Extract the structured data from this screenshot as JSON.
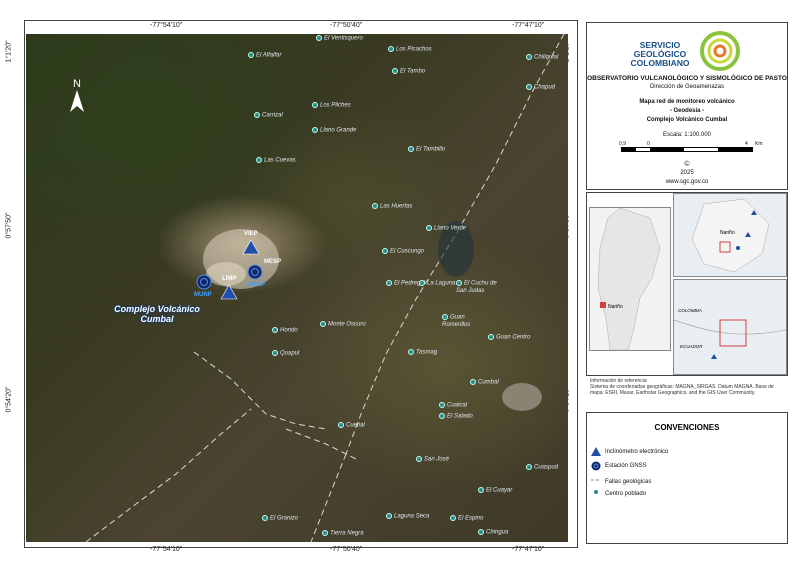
{
  "coords": {
    "top": [
      "-77°54'10\"",
      "-77°50'40\"",
      "-77°47'10\""
    ],
    "bottom": [
      "-77°54'10\"",
      "-77°50'40\"",
      "-77°47'10\""
    ],
    "left": [
      "1°1'20\"",
      "0°57'50\"",
      "0°54'20\""
    ],
    "right": [
      "1°1'20\"",
      "0°57'50\"",
      "0°54'20\""
    ]
  },
  "north": "N",
  "volcano": {
    "line1": "Complejo Volcánico",
    "line2": "Cumbal"
  },
  "stations": {
    "inclinometers": [
      "VIEP",
      "LIMP"
    ],
    "gnss": [
      "MESP",
      "MUNP"
    ],
    "mesp_secondary": "MESP"
  },
  "places": [
    "El Ventisquero",
    "Los Picachos",
    "El Alfalfar",
    "Chiliquial",
    "El Tambo",
    "Chapud",
    "Los Pilches",
    "Carrizal",
    "Llano Grande",
    "El Tambillo",
    "Las Cuevas",
    "Las Huertas",
    "Llano Verde",
    "El Cuscungo",
    "El Pedregal",
    "La Laguna",
    "El Cuchu de San Judas",
    "Guan Romerillos",
    "Guan Centro",
    "Hondo",
    "Monte Oscuro",
    "Quapul",
    "Tasmag",
    "Cumbal",
    "Cuetial",
    "Cualcal",
    "El Salado",
    "San José",
    "Cuaspud",
    "El Cuayar",
    "El Granizo",
    "Laguna Seca",
    "El Espino",
    "Tierra Negra",
    "Chingua"
  ],
  "header": {
    "logo_line1": "SERVICIO",
    "logo_line2": "GEOLÓGICO",
    "logo_line3": "COLOMBIANO",
    "observatory": "OBSERVATORIO VULCANOLÓGICO Y SISMOLÓGICO DE PASTO",
    "direction": "Dirección de Geoamenazas",
    "map_title": "Mapa red de monitoreo volcánico",
    "subtitle": "- Geodesia -",
    "volcano": "Complejo Volcánico Cumbal",
    "scale": "Escala: 1:100.000",
    "scale_ticks": [
      "0,9",
      "0",
      "4",
      "Km"
    ],
    "copyright": "©",
    "year": "2025",
    "website": "www.sgc.gov.co"
  },
  "insets": {
    "narino_label": "Nariño",
    "narino_label2": "Nariño",
    "colombia": "COLOMBIA",
    "ecuador": "ECUADOR"
  },
  "reference": {
    "title": "Información de referencia",
    "body": "Sistema de coordenadas geográficas: MAGNA_SIRGAS. Datum MAGNA. Base de mapa: ESRI, Maxar, Earthstar Geographics, and the GIS User Community."
  },
  "legend": {
    "title": "CONVENCIONES",
    "items": [
      "Inclinómetro electrónico",
      "Estación GNSS",
      "Fallas geológicas",
      "Centro poblado"
    ]
  },
  "colors": {
    "accent_blue": "#1b4f8a",
    "station_blue": "#1f4fa8",
    "logo_green": "#8ac43f",
    "logo_orange": "#e9772a"
  }
}
